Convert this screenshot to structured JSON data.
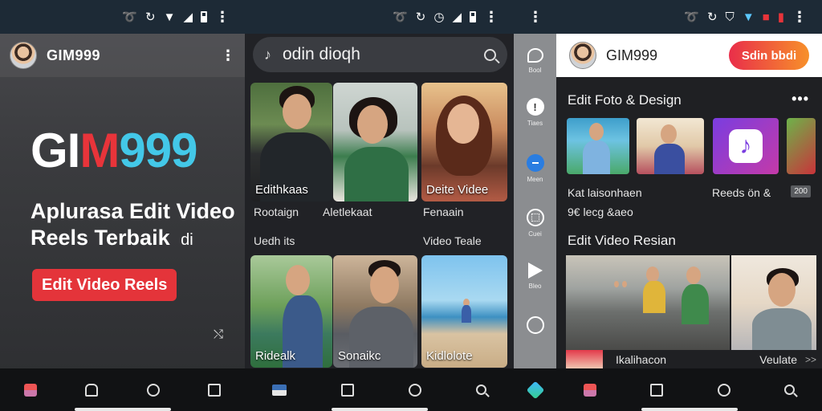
{
  "screen1": {
    "app_name": "GIM999",
    "hero_logo": {
      "part1": "GI",
      "part2": "M",
      "part3": "999"
    },
    "hero_text": "Aplurasa Edit Video Reels Terbaik",
    "hero_text_suffix": "di",
    "cta_label": "Edit Video Reels"
  },
  "screen2": {
    "search_query": "odin dioqh",
    "tiles_row1": [
      {
        "caption": "Edithkaas",
        "sub": "Rootaign"
      },
      {
        "caption": "",
        "sub": "Aletlekaat"
      },
      {
        "caption": "Deite Videe",
        "sub": "Fenaain"
      }
    ],
    "row_labels": {
      "left": "Uedh its",
      "right": "Video Teale"
    },
    "tiles_row2": [
      {
        "caption": "Ridealk"
      },
      {
        "caption": "Sonaikc"
      },
      {
        "caption": "Kidlolote"
      }
    ]
  },
  "screen3": {
    "rail_labels": [
      "Bool",
      "Tiaes",
      "Meen",
      "Cuei",
      "Bleo",
      ""
    ]
  },
  "screen4": {
    "app_name": "GIM999",
    "header_button": "Sdin bbdi",
    "section1_title": "Edit Foto & Design",
    "label_left": "Kat laisonhaen",
    "label_right": "Reeds ön &",
    "tag": "200",
    "sub_label": "9€ lecg &aeo",
    "section2_title": "Edit Video Resian",
    "strip_left": "Ikalihacon",
    "strip_right": "Veulate",
    "strip_chevron": ">>"
  },
  "colors": {
    "accent_red": "#e4343a",
    "brand_cyan": "#43c8e8",
    "gradient_start": "#e92e4a",
    "gradient_end": "#f7902a"
  }
}
